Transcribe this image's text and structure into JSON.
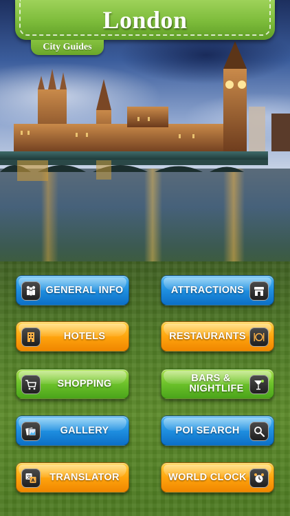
{
  "header": {
    "title": "London",
    "subtitle": "City Guides"
  },
  "colors": {
    "banner_green": "#7cbb3a",
    "button_blue": "#1f8fe0",
    "button_orange": "#ffa50e",
    "button_green": "#6cc12a"
  },
  "menu": {
    "general_info": {
      "label": "GENERAL INFO",
      "icon": "people-icon"
    },
    "attractions": {
      "label": "ATTRACTIONS",
      "icon": "storefront-icon"
    },
    "hotels": {
      "label": "HOTELS",
      "icon": "hotel-building-icon"
    },
    "restaurants": {
      "label": "RESTAURANTS",
      "icon": "plate-cutlery-icon"
    },
    "shopping": {
      "label": "SHOPPING",
      "icon": "shopping-cart-icon"
    },
    "bars": {
      "label_line1": "BARS &",
      "label_line2": "NIGHTLIFE",
      "icon": "cocktail-glass-icon"
    },
    "gallery": {
      "label": "GALLERY",
      "icon": "photos-icon"
    },
    "poi_search": {
      "label": "POI SEARCH",
      "icon": "magnifier-icon"
    },
    "translator": {
      "label": "TRANSLATOR",
      "icon": "translate-icon"
    },
    "world_clock": {
      "label": "WORLD CLOCK",
      "icon": "alarm-clock-icon"
    }
  }
}
